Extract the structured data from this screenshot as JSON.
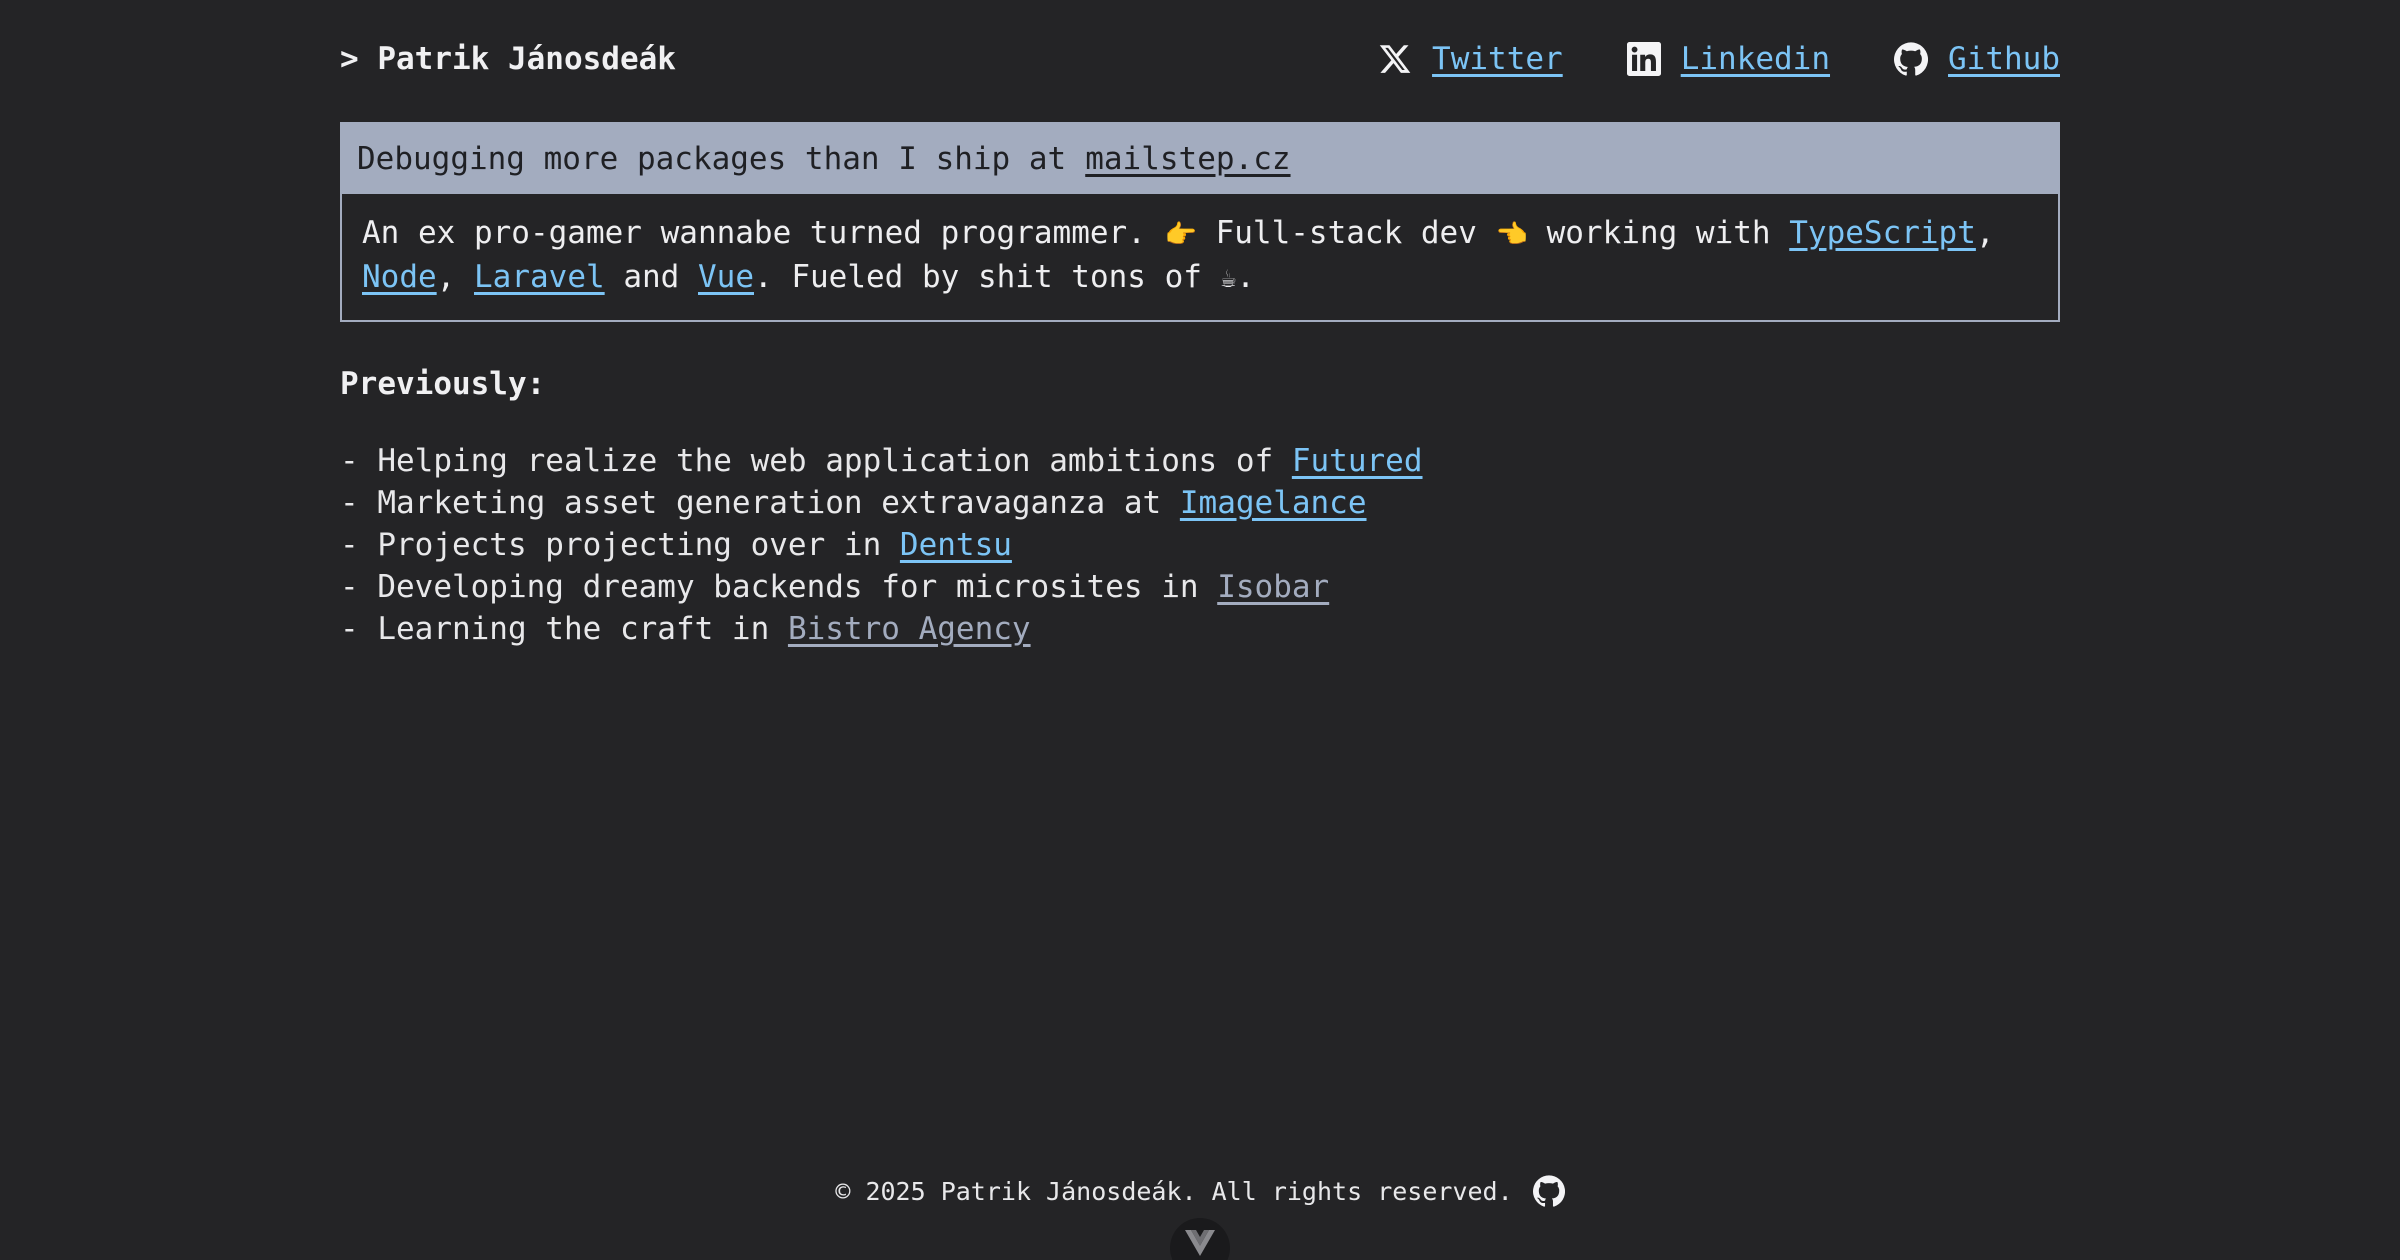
{
  "header": {
    "brand": "> Patrik Jánosdeák",
    "social": [
      {
        "label": "Twitter",
        "icon": "x-logo-icon"
      },
      {
        "label": "Linkedin",
        "icon": "linkedin-icon"
      },
      {
        "label": "Github",
        "icon": "github-icon"
      }
    ]
  },
  "card": {
    "head_text": "Debugging more packages than I ship at",
    "head_link": "mailstep.cz",
    "body": {
      "t1": "An ex pro-gamer wannabe turned programmer.",
      "emoji1": "👉",
      "t2": "Full-stack dev",
      "emoji2": "👈",
      "t3": "working with",
      "link_typescript": "TypeScript",
      "sep1": ",",
      "link_node": "Node",
      "sep2": ",",
      "link_laravel": "Laravel",
      "t4": "and",
      "link_vue": "Vue",
      "t5": ". Fueled by shit tons of",
      "emoji3": "☕",
      "t6": "."
    }
  },
  "previously": {
    "heading": "Previously:",
    "items": [
      {
        "text": "- Helping realize the web application ambitions of",
        "link": "Futured",
        "style": "active"
      },
      {
        "text": "- Marketing asset generation extravaganza at",
        "link": "Imagelance",
        "style": "active"
      },
      {
        "text": "- Projects projecting over in",
        "link": "Dentsu",
        "style": "active"
      },
      {
        "text": "- Developing dreamy backends for microsites in",
        "link": "Isobar",
        "style": "muted"
      },
      {
        "text": "- Learning the craft in",
        "link": "Bistro Agency",
        "style": "muted"
      }
    ]
  },
  "footer": {
    "copyright": "© 2025 Patrik Jánosdeák. All rights reserved.",
    "icon": "github-icon"
  },
  "colors": {
    "background": "#242426",
    "accent_link": "#7cc4f5",
    "muted_link": "#a3acbf",
    "card_header_bg": "#a3acbf"
  }
}
